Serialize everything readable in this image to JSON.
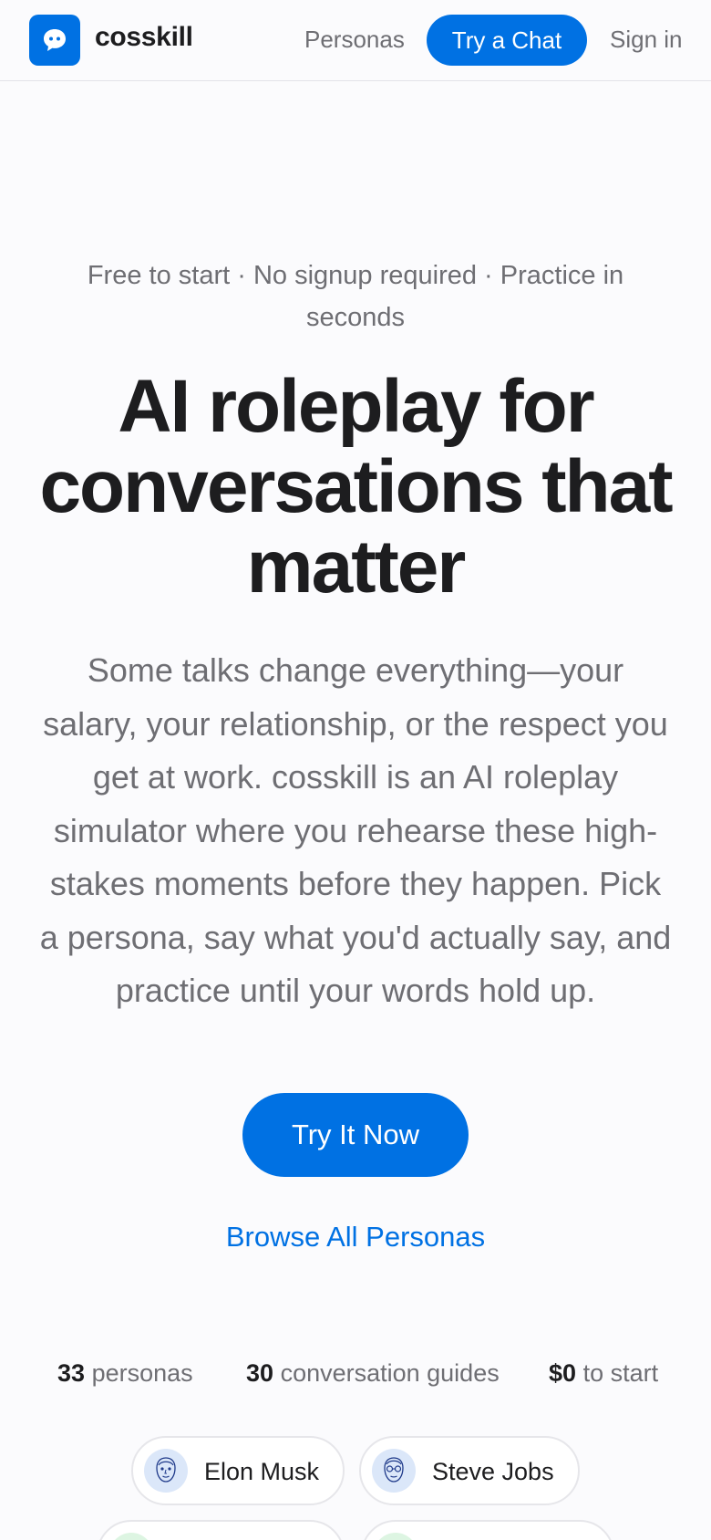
{
  "header": {
    "brand": "cosskill",
    "logo_icon": "chat-bubble-icon",
    "nav_personas": "Personas",
    "nav_cta": "Try a Chat",
    "nav_signin": "Sign in"
  },
  "hero": {
    "tagline": "Free to start · No signup required · Practice in seconds",
    "headline": "AI roleplay for conversations that matter",
    "description": "Some talks change everything—your salary, your relationship, or the respect you get at work. cosskill is an AI roleplay simulator where you rehearse these high-stakes moments before they happen. Pick a persona, say what you'd actually say, and practice until your words hold up.",
    "cta_primary": "Try It Now",
    "cta_secondary": "Browse All Personas"
  },
  "stats": [
    {
      "value": "33",
      "label": "personas"
    },
    {
      "value": "30",
      "label": "conversation guides"
    },
    {
      "value": "$0",
      "label": "to start"
    }
  ],
  "personas": [
    {
      "name": "Elon Musk",
      "icon": "face-sketch-icon"
    },
    {
      "name": "Steve Jobs",
      "icon": "face-glasses-sketch-icon"
    }
  ],
  "colors": {
    "accent": "#0071e3",
    "text_primary": "#1d1d1f",
    "text_secondary": "#6e6e73",
    "background": "#fbfbfd"
  }
}
